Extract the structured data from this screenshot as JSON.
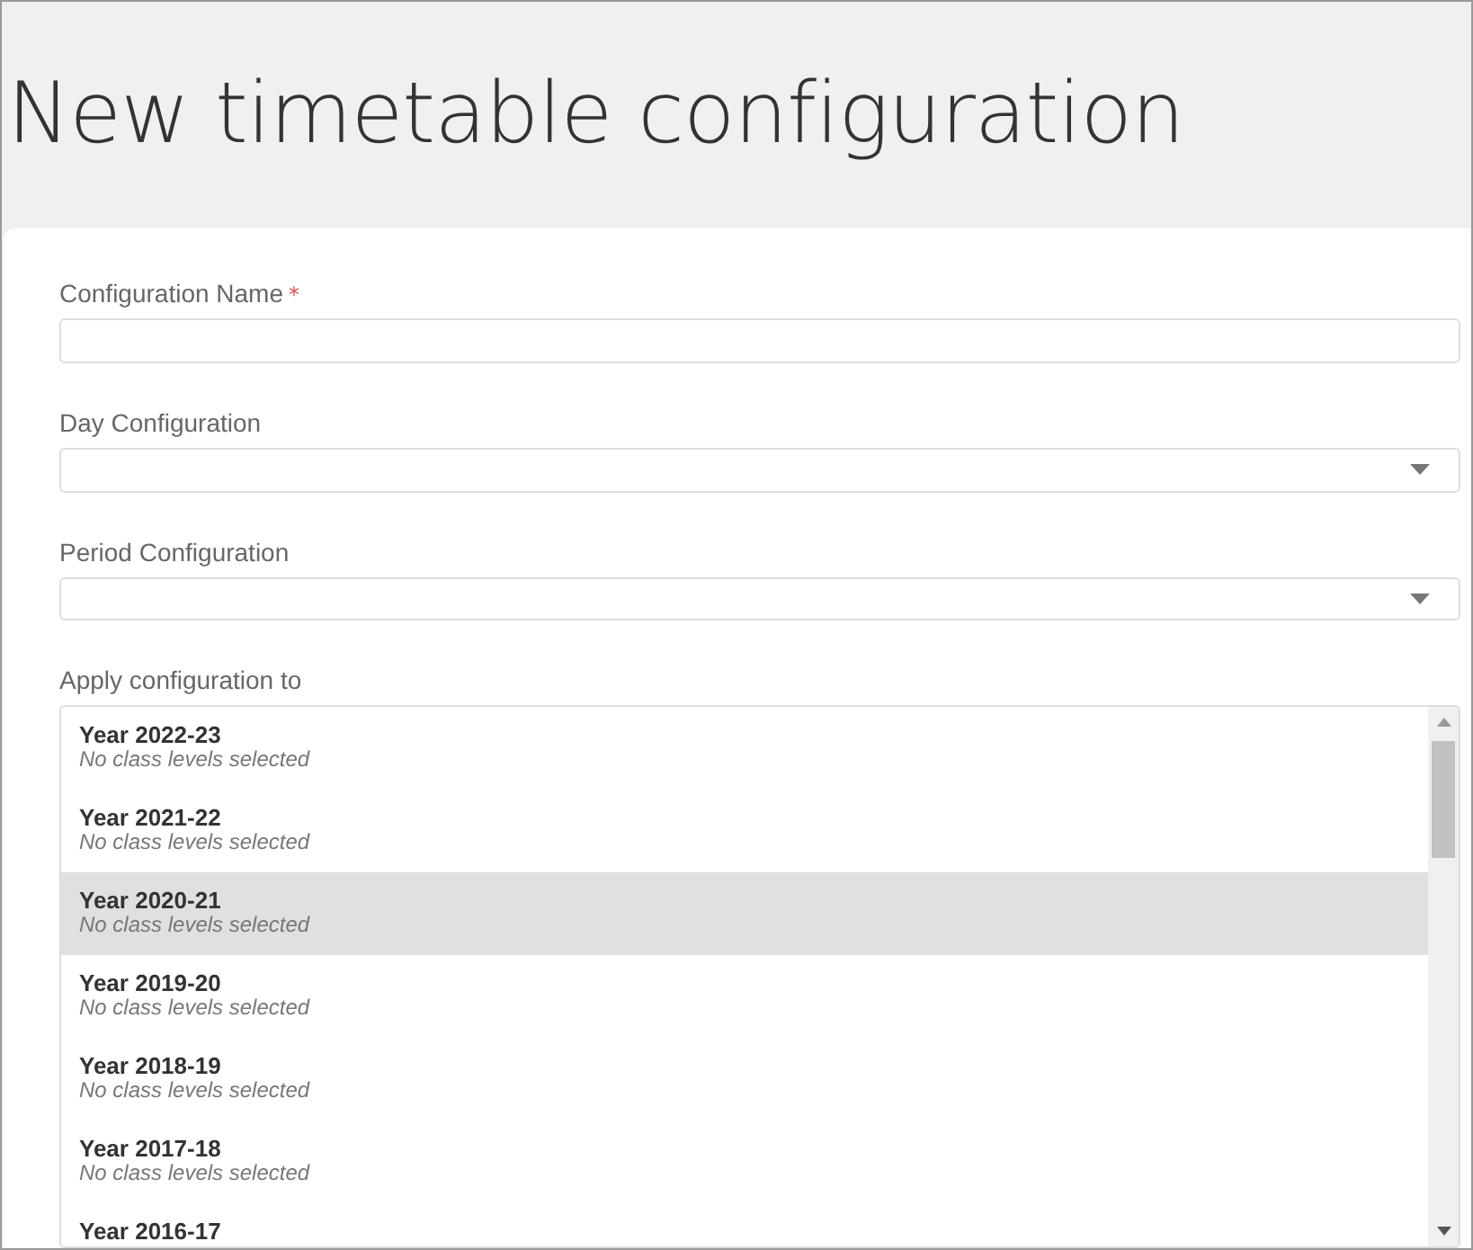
{
  "page": {
    "title": "New timetable configuration"
  },
  "form": {
    "name_field": {
      "label": "Configuration Name",
      "required_mark": "*"
    },
    "day_configuration": {
      "label": "Day Configuration"
    },
    "period_configuration": {
      "label": "Period Configuration"
    },
    "apply_to": {
      "label": "Apply configuration to",
      "items": [
        {
          "title": "Year 2022-23",
          "subtitle": "No class levels selected",
          "selected": false
        },
        {
          "title": "Year 2021-22",
          "subtitle": "No class levels selected",
          "selected": false
        },
        {
          "title": "Year 2020-21",
          "subtitle": "No class levels selected",
          "selected": true
        },
        {
          "title": "Year 2019-20",
          "subtitle": "No class levels selected",
          "selected": false
        },
        {
          "title": "Year 2018-19",
          "subtitle": "No class levels selected",
          "selected": false
        },
        {
          "title": "Year 2017-18",
          "subtitle": "No class levels selected",
          "selected": false
        },
        {
          "title": "Year 2016-17",
          "selected": false
        }
      ]
    }
  }
}
